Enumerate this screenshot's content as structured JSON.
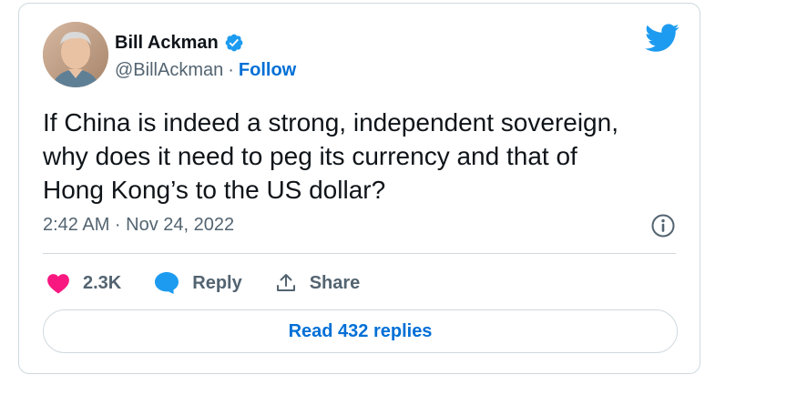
{
  "tweet": {
    "author": {
      "name": "Bill Ackman",
      "handle": "@BillAckman",
      "separator": "·",
      "follow_label": "Follow",
      "verified": true
    },
    "text": "If China is indeed a strong, independent sovereign,\nwhy does it need to peg its currency and that of\nHong Kong’s to the US dollar?",
    "timestamp": "2:42 AM · Nov 24, 2022",
    "actions": {
      "like_count": "2.3K",
      "reply_label": "Reply",
      "share_label": "Share"
    },
    "read_replies_label": "Read 432 replies"
  },
  "icons": {
    "brand": "twitter-bird-icon",
    "verified": "verified-badge-icon",
    "info": "info-icon",
    "like": "heart-icon",
    "reply": "speech-bubble-icon",
    "share": "share-upload-icon"
  },
  "colors": {
    "brand_blue": "#1d9bf0",
    "link_blue": "#006fd6",
    "like_pink": "#f91880",
    "muted_text": "#536471",
    "border": "#cfd9de"
  }
}
